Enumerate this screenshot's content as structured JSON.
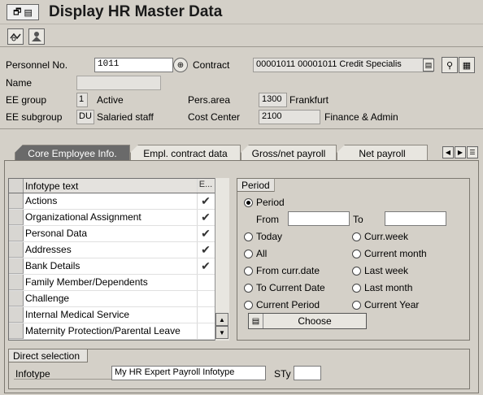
{
  "title": "Display HR Master Data",
  "header": {
    "personnel_no_label": "Personnel No.",
    "personnel_no_value": "1011",
    "contract_label": "Contract",
    "contract_value": "00001011 00001011 Credit Specialis",
    "name_label": "Name",
    "name_value": "",
    "ee_group_label": "EE group",
    "ee_group_code": "1",
    "ee_group_text": "Active",
    "pers_area_label": "Pers.area",
    "pers_area_code": "1300",
    "pers_area_text": "Frankfurt",
    "ee_subgroup_label": "EE subgroup",
    "ee_subgroup_code": "DU",
    "ee_subgroup_text": "Salaried staff",
    "cost_center_label": "Cost Center",
    "cost_center_code": "2100",
    "cost_center_text": "Finance & Admin"
  },
  "tabs": [
    {
      "label": "Core Employee Info."
    },
    {
      "label": "Empl. contract data"
    },
    {
      "label": "Gross/net payroll"
    },
    {
      "label": "Net payroll"
    }
  ],
  "infotype_table": {
    "col_text": "Infotype text",
    "col_e": "E...",
    "rows": [
      {
        "text": "Actions",
        "check": "✔"
      },
      {
        "text": "Organizational Assignment",
        "check": "✔"
      },
      {
        "text": "Personal Data",
        "check": "✔"
      },
      {
        "text": "Addresses",
        "check": "✔"
      },
      {
        "text": "Bank Details",
        "check": "✔"
      },
      {
        "text": "Family Member/Dependents",
        "check": ""
      },
      {
        "text": "Challenge",
        "check": ""
      },
      {
        "text": "Internal Medical Service",
        "check": ""
      },
      {
        "text": "Maternity Protection/Parental Leave",
        "check": ""
      }
    ]
  },
  "period": {
    "group_label": "Period",
    "period_option": "Period",
    "from_label": "From",
    "to_label": "To",
    "from_value": "",
    "to_value": "",
    "options_left": [
      "Today",
      "All",
      "From curr.date",
      "To Current Date",
      "Current Period"
    ],
    "options_right": [
      "Curr.week",
      "Current month",
      "Last week",
      "Last month",
      "Current Year"
    ],
    "choose_label": "Choose"
  },
  "direct_selection": {
    "group_label": "Direct selection",
    "infotype_label": "Infotype",
    "infotype_value": "My HR Expert Payroll Infotype",
    "sty_label": "STy",
    "sty_value": ""
  },
  "icons": {
    "title": [
      "display-icon",
      "document-icon"
    ],
    "toolbar": [
      "overview-icon",
      "person-icon"
    ],
    "contract_buttons": [
      "filter-icon",
      "organization-icon"
    ],
    "tab_nav": [
      "tab-left-icon",
      "tab-right-icon",
      "tab-list-icon"
    ]
  }
}
